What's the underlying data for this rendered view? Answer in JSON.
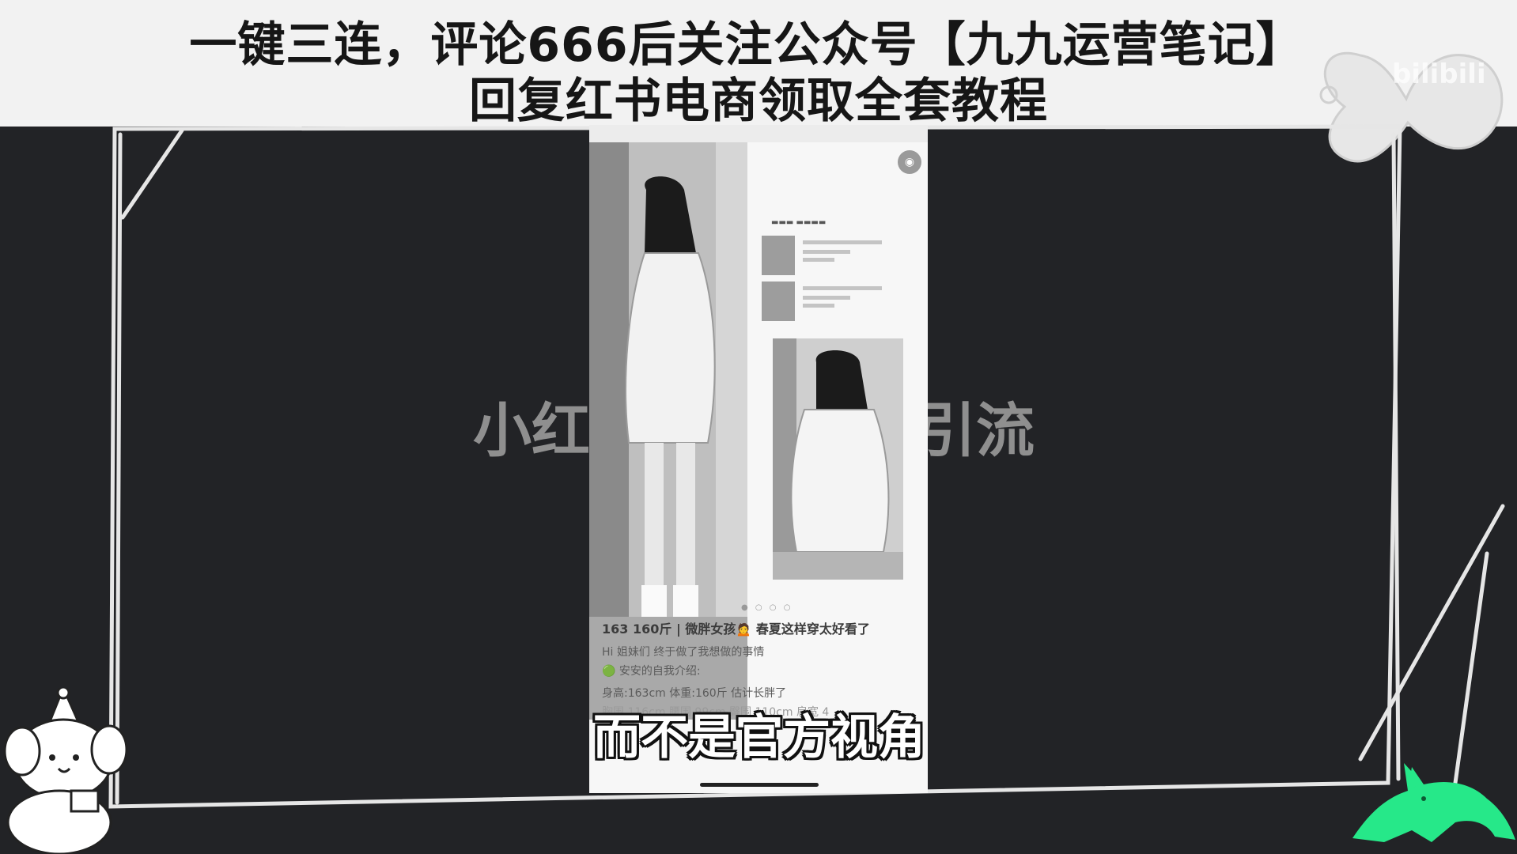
{
  "banner": {
    "line1": "一键三连，评论666后关注公众号【九九运营笔记】",
    "line2": "回复红书电商领取全套教程"
  },
  "background_title": {
    "left": "小红",
    "right": "引流"
  },
  "subtitle": "而不是官方视角",
  "phone": {
    "post_title": "163 160斤 | 微胖女孩🙍 春夏这样穿太好看了",
    "post_lines": [
      "Hi 姐妹们 终于做了我想做的事情",
      "🟢 安安的自我介绍:",
      "身高:163cm  体重:160斤  估计长胖了",
      "胸围 116cm  腰围 99cm  臀围 110cm  肩宽 4"
    ]
  },
  "icons": {
    "brand_logo": "bilibili-logo",
    "left_sticker": "puppy-birthday-cake-sticker",
    "right_sticker": "green-cat-sticker",
    "phone_avatar": "avatar-icon"
  },
  "colors": {
    "background": "#222326",
    "banner": "#f2f2f2",
    "cat": "#26e889"
  }
}
